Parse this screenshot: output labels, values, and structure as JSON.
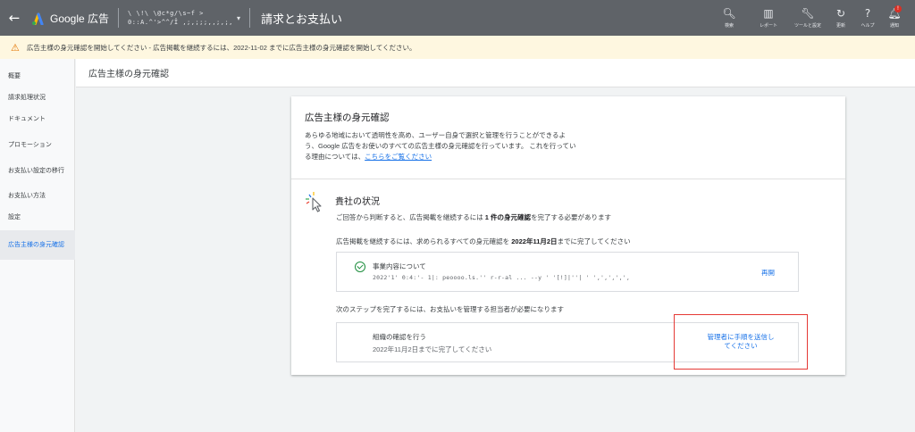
{
  "topbar": {
    "back_icon": "arrow-back-icon",
    "brand": "Google 広告",
    "account_line1": "\\ \\!\\ \\@c*g/\\s~f >",
    "account_line2": "0::A.^'>^^/Ǐ ,;,;;;,,;,;,",
    "page_heading": "請求とお支払い",
    "tools": [
      {
        "icon": "search-icon",
        "glyph": "🔍︎",
        "label": "検索"
      },
      {
        "icon": "reports-icon",
        "glyph": "▥",
        "label": "レポート"
      },
      {
        "icon": "wrench-icon",
        "glyph": "🔧︎",
        "label": "ツールと設定"
      },
      {
        "icon": "refresh-icon",
        "glyph": "↻",
        "label": "更新"
      },
      {
        "icon": "help-icon",
        "glyph": "?",
        "label": "ヘルプ"
      },
      {
        "icon": "bell-icon",
        "glyph": "🔔︎",
        "label": "通知",
        "badge": "!"
      }
    ],
    "colors": {
      "bar": "#5f6368"
    }
  },
  "banner": {
    "icon": "warning-icon",
    "glyph": "⚠",
    "text": "広告主様の身元確認を開始してください - 広告掲載を継続するには、2022-11-02 までに広告主様の身元確認を開始してください。"
  },
  "sidebar": {
    "items": [
      {
        "label": "概要"
      },
      {
        "label": "請求処理状況"
      },
      {
        "label": "ドキュメント"
      },
      {
        "label": "プロモーション"
      },
      {
        "label": "お支払い設定の移行"
      },
      {
        "label": "お支払い方法"
      },
      {
        "label": "設定"
      },
      {
        "label": "広告主様の身元確認",
        "active": true
      }
    ]
  },
  "content_header": {
    "title": "広告主様の身元確認"
  },
  "card": {
    "title": "広告主様の身元確認",
    "desc_line1": "あらゆる地域において透明性を高め、ユーザー自身で選択と管理を行うことができるよ",
    "desc_line2": "う、Google 広告をお使いのすべての広告主様の身元確認を行っています。 これを行ってい",
    "desc_line3": "る理由については、",
    "desc_link": "こちらをご覧ください",
    "status_icon": "cursor-sparkle-icon",
    "status_title": "貴社の状況",
    "status_sub_pre": "ご回答から判断すると、広告掲載を継続するには ",
    "status_sub_bold": "1 件の身元確認",
    "status_sub_post": "を完了する必要があります",
    "deadline_pre": "広告掲載を継続するには、求められるすべての身元確認を ",
    "deadline_bold": "2022年11月2日",
    "deadline_post": "までに完了してください",
    "item1": {
      "icon": "check-circle-icon",
      "title": "事業内容について",
      "detail": "2022'1' 0:4:'- 1|: peoooo.ls.'' r-r-al ... --y ' '[!]|''| ' ',',',',',",
      "action": "再開"
    },
    "next_step": "次のステップを完了するには、お支払いを管理する担当者が必要になります",
    "item2": {
      "title": "組織の確認を行う",
      "subtitle": "2022年11月2日までに完了してください",
      "action_line1": "管理者に手順を送信し",
      "action_line2": "てください"
    }
  },
  "annotation": {
    "color": "#e53935"
  }
}
